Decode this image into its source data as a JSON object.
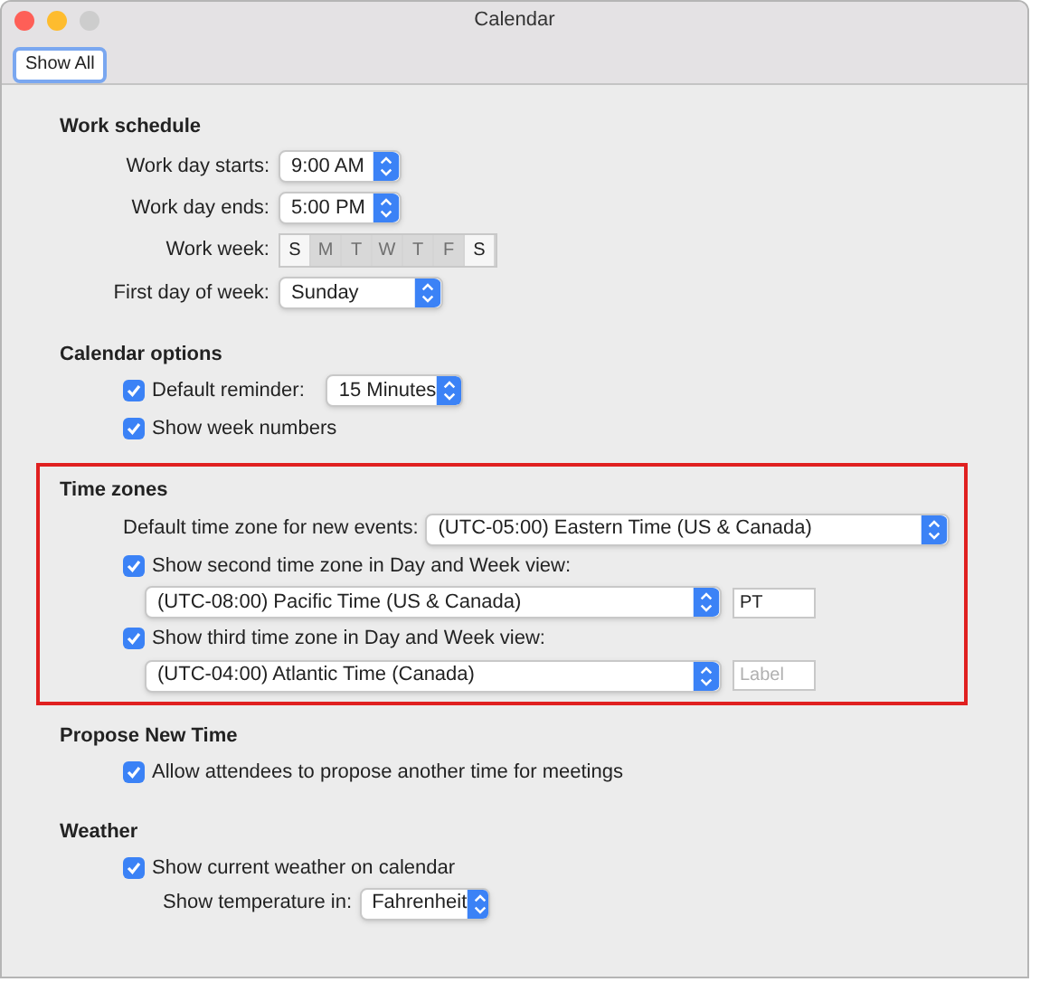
{
  "window": {
    "title": "Calendar"
  },
  "toolbar": {
    "show_all": "Show All"
  },
  "work_schedule": {
    "heading": "Work schedule",
    "day_starts": {
      "label": "Work day starts:",
      "value": "9:00 AM"
    },
    "day_ends": {
      "label": "Work day ends:",
      "value": "5:00 PM"
    },
    "work_week": {
      "label": "Work week:",
      "days": [
        {
          "label": "S",
          "selected": false
        },
        {
          "label": "M",
          "selected": true
        },
        {
          "label": "T",
          "selected": true
        },
        {
          "label": "W",
          "selected": true
        },
        {
          "label": "T",
          "selected": true
        },
        {
          "label": "F",
          "selected": true
        },
        {
          "label": "S",
          "selected": false
        }
      ]
    },
    "first_day": {
      "label": "First day of week:",
      "value": "Sunday"
    }
  },
  "calendar_options": {
    "heading": "Calendar options",
    "default_reminder": {
      "label": "Default reminder:",
      "checked": true,
      "value": "15 Minutes"
    },
    "week_numbers": {
      "label": "Show week numbers",
      "checked": true
    }
  },
  "time_zones": {
    "heading": "Time zones",
    "highlighted": true,
    "default_zone": {
      "label": "Default time zone for new events:",
      "value": "(UTC-05:00) Eastern Time (US & Canada)"
    },
    "second_zone": {
      "label": "Show second time zone in Day and Week view:",
      "checked": true,
      "zone": "(UTC-08:00) Pacific Time (US & Canada)",
      "abbreviation": {
        "value": "PT"
      }
    },
    "third_zone": {
      "label": "Show third time zone in Day and Week view:",
      "checked": true,
      "zone": "(UTC-04:00) Atlantic Time (Canada)",
      "abbreviation": {
        "placeholder": "Label"
      }
    }
  },
  "propose_new_time": {
    "heading": "Propose New Time",
    "allow": {
      "label": "Allow attendees to propose another time for meetings",
      "checked": true
    }
  },
  "weather": {
    "heading": "Weather",
    "show_weather": {
      "label": "Show current weather on calendar",
      "checked": true
    },
    "temperature": {
      "label": "Show temperature in:",
      "value": "Fahrenheit"
    }
  }
}
